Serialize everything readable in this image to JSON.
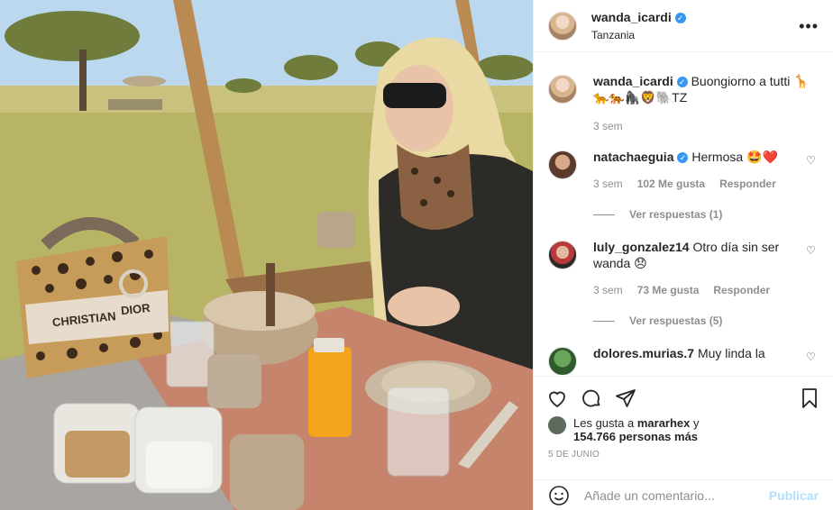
{
  "post": {
    "photo": {
      "description": "bag print lettering",
      "bag_text_line1": "CHRISTIAN",
      "bag_text_line2": "DIOR"
    },
    "header": {
      "username": "wanda_icardi",
      "location": "Tanzania",
      "verified_icon": "verified-badge-icon",
      "more_icon": "more-options-icon"
    },
    "caption": {
      "username": "wanda_icardi",
      "text": "Buongiorno a tutti 🦒",
      "text_line2": "🐆🐅🦍🦁🐘TZ",
      "time": "3 sem"
    },
    "comments": [
      {
        "username": "natachaeguia",
        "verified": true,
        "text": "Hermosa 🤩❤️",
        "time": "3 sem",
        "likes": "102 Me gusta",
        "reply": "Responder",
        "view_replies": "Ver respuestas (1)"
      },
      {
        "username": "luly_gonzalez14",
        "verified": false,
        "text": "Otro día sin ser",
        "text_line2": "wanda 😞",
        "time": "3 sem",
        "likes": "73 Me gusta",
        "reply": "Responder",
        "view_replies": "Ver respuestas (5)"
      },
      {
        "username": "dolores.murias.7",
        "verified": false,
        "text": "Muy linda la"
      }
    ],
    "likes": {
      "prefix": "Les gusta a",
      "user": "mararhex",
      "conj": "y",
      "count_text": "154.766 personas más"
    },
    "date": "5 DE JUNIO",
    "add_comment": {
      "placeholder": "Añade un comentario...",
      "publish": "Publicar"
    },
    "colors": {
      "verified": "#3897f0",
      "publish_disabled": "#b2dffc",
      "secondary_text": "#8e8e8e"
    }
  }
}
